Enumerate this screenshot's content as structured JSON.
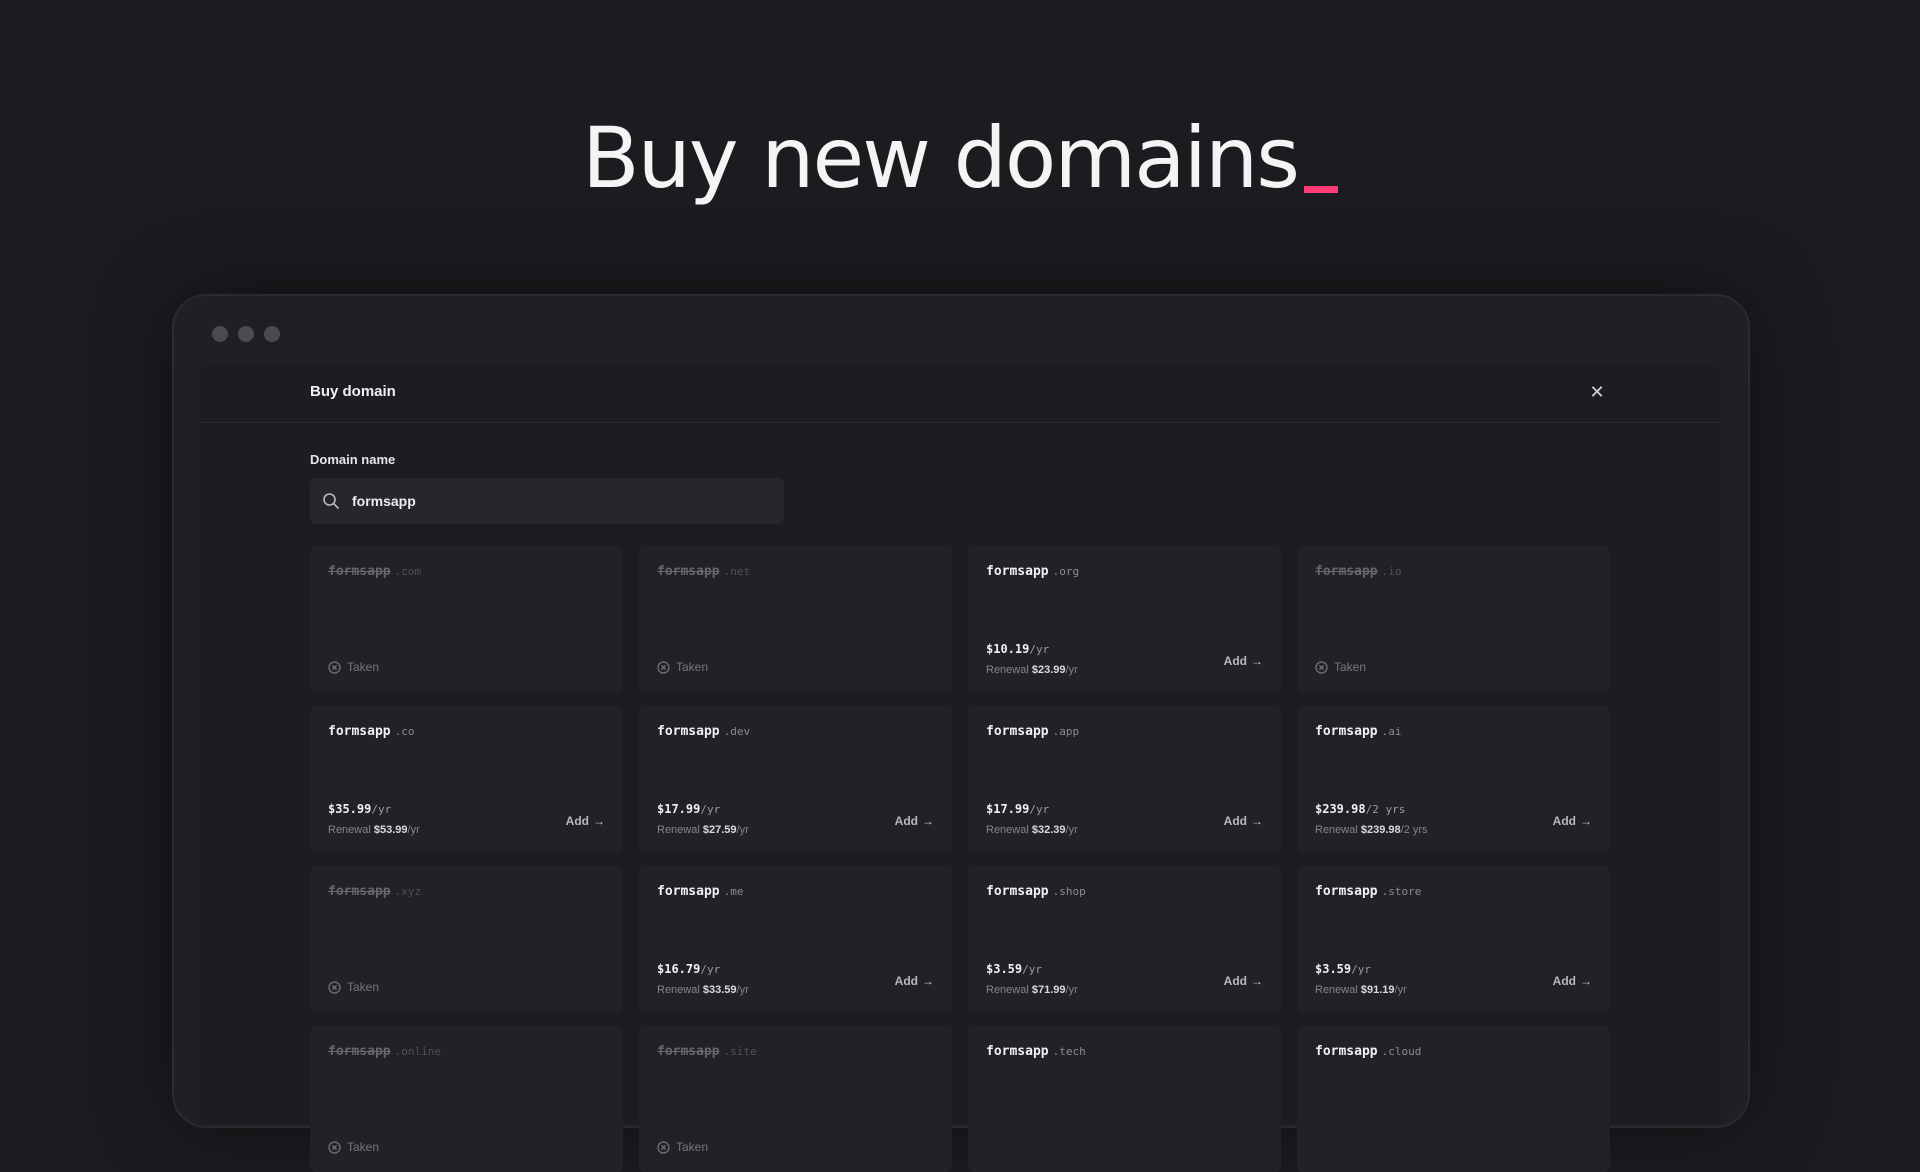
{
  "headline": "Buy new domains",
  "dialog": {
    "title": "Buy domain",
    "close_icon": "close-icon",
    "field_label": "Domain name",
    "search_value": "formsapp"
  },
  "labels": {
    "taken": "Taken",
    "add": "Add",
    "renewal": "Renewal"
  },
  "domains": [
    {
      "name": "formsapp",
      "tld": ".com",
      "taken": true
    },
    {
      "name": "formsapp",
      "tld": ".net",
      "taken": true
    },
    {
      "name": "formsapp",
      "tld": ".org",
      "taken": false,
      "price": "$10.19",
      "per": "/yr",
      "renewal": "$23.99",
      "renewal_per": "/yr"
    },
    {
      "name": "formsapp",
      "tld": ".io",
      "taken": true
    },
    {
      "name": "formsapp",
      "tld": ".co",
      "taken": false,
      "price": "$35.99",
      "per": "/yr",
      "renewal": "$53.99",
      "renewal_per": "/yr"
    },
    {
      "name": "formsapp",
      "tld": ".dev",
      "taken": false,
      "price": "$17.99",
      "per": "/yr",
      "renewal": "$27.59",
      "renewal_per": "/yr"
    },
    {
      "name": "formsapp",
      "tld": ".app",
      "taken": false,
      "price": "$17.99",
      "per": "/yr",
      "renewal": "$32.39",
      "renewal_per": "/yr"
    },
    {
      "name": "formsapp",
      "tld": ".ai",
      "taken": false,
      "price": "$239.98",
      "per": "/2 yrs",
      "renewal": "$239.98",
      "renewal_per": "/2 yrs"
    },
    {
      "name": "formsapp",
      "tld": ".xyz",
      "taken": true
    },
    {
      "name": "formsapp",
      "tld": ".me",
      "taken": false,
      "price": "$16.79",
      "per": "/yr",
      "renewal": "$33.59",
      "renewal_per": "/yr"
    },
    {
      "name": "formsapp",
      "tld": ".shop",
      "taken": false,
      "price": "$3.59",
      "per": "/yr",
      "renewal": "$71.99",
      "renewal_per": "/yr"
    },
    {
      "name": "formsapp",
      "tld": ".store",
      "taken": false,
      "price": "$3.59",
      "per": "/yr",
      "renewal": "$91.19",
      "renewal_per": "/yr"
    },
    {
      "name": "formsapp",
      "tld": ".online",
      "taken": true
    },
    {
      "name": "formsapp",
      "tld": ".site",
      "taken": true
    },
    {
      "name": "formsapp",
      "tld": ".tech",
      "taken": false
    },
    {
      "name": "formsapp",
      "tld": ".cloud",
      "taken": false
    }
  ],
  "colors": {
    "background": "#1b1c1f",
    "accent": "#ff3b77",
    "card": "#212225"
  }
}
